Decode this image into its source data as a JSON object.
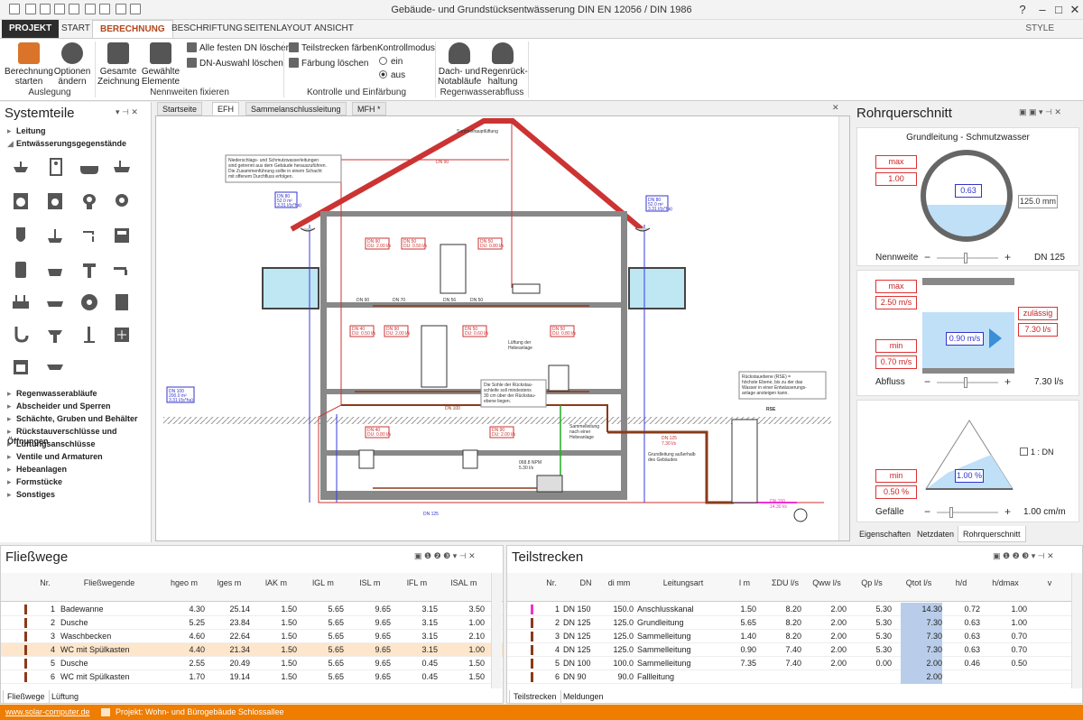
{
  "window": {
    "title": "Gebäude- und Grundstücksentwässerung DIN EN 12056 / DIN 1986",
    "style_label": "STYLE"
  },
  "ribbon_tabs": [
    "PROJEKT",
    "START",
    "BERECHNUNG",
    "BESCHRIFTUNG",
    "SEITENLAYOUT",
    "ANSICHT"
  ],
  "ribbon": {
    "btn_start": "Berechnung starten",
    "btn_options": "Optionen ändern",
    "grp_ausl": "Auslegung",
    "btn_whole": "Gesamte Zeichnung",
    "btn_sel": "Gewählte Elemente",
    "fix_all": "Alle festen DN löschen",
    "dn_clear": "DN-Auswahl löschen",
    "grp_nenn": "Nennweiten fixieren",
    "color_parts": "Teilstrecken färben",
    "color_clear": "Färbung löschen",
    "mode_title": "Kontrollmodus",
    "mode_on": "ein",
    "mode_off": "aus",
    "grp_ktrl": "Kontrolle und Einfärbung",
    "btn_roof": "Dach- und Notabläufe",
    "btn_rain": "Regenrück-haltung",
    "grp_rain": "Regenwasserabfluss"
  },
  "left": {
    "title": "Systemteile",
    "items": [
      "Leitung",
      "Entwässerungsgegenstände",
      "Regenwasserabläufe",
      "Abscheider und Sperren",
      "Schächte, Gruben und Behälter",
      "Rückstauverschlüsse und Öffnungen",
      "Lüftungsanschlüsse",
      "Ventile und Armaturen",
      "Hebeanlagen",
      "Formstücke",
      "Sonstiges"
    ]
  },
  "doc_tabs": [
    "Startseite",
    "EFH",
    "Sammelanschlussleitung",
    "MFH *"
  ],
  "drawing": {
    "note1": [
      "Niederschlags- und Schmutzwasserleitungen",
      "sind getrennt aus dem Gebäude herauszuführen.",
      "Die Zusammenführung sollte in einem Schacht",
      "mit offenem Durchfluss erfolgen."
    ],
    "note2": [
      "Rückstauebene (RSE) =",
      "höchste Ebene, bis zu der das",
      "Wasser in einer Entwässerungs-",
      "anlage ansteigen kann."
    ],
    "note3": [
      "Die Sohle der Rückstau-",
      "schleife soll mindestens",
      "30 cm über der Rückstau-",
      "ebene liegen."
    ],
    "vent": "Sammelhauptlüftung",
    "lift_vent": [
      "Lüftung der",
      "Hebeanlage"
    ],
    "lift": [
      "Sammelleitung",
      "nach einer",
      "Hebeanlage"
    ],
    "ground": [
      "Grundleitung außerhalb",
      "des Gebäudes"
    ],
    "rse": "RSE",
    "dn90": "DN 90",
    "dn70": "DN 70",
    "dn56": "DN 56",
    "dn50": "DN 50",
    "dn100": "DN 100",
    "dn125": "DN 125",
    "roof_l": [
      "DN 80",
      "52.0 m²",
      "3.31 l/(s*ha)"
    ],
    "roof_r": [
      "DN 80",
      "52.0 m²",
      "3.31 l/(s*ha)"
    ],
    "rain": [
      "DN 100",
      "200.0 m²",
      "3.31 l/(s*ha)"
    ],
    "dn125b": [
      "DN 125",
      "7.30 l/s"
    ],
    "dn150": [
      "DN 150",
      "14.30 l/s"
    ],
    "pump": [
      "068.8 NPM",
      "5.30 l/s"
    ],
    "fix": [
      "DN 90",
      "DU: 2.00 l/s",
      "DN 50",
      "DU: 0.50 l/s",
      "DN 50",
      "DU: 0.80 l/s",
      "DN 40",
      "DU: 0.50 l/s",
      "DN 90",
      "DU: 2.00 l/s",
      "DN 50",
      "DU: 0.60 l/s",
      "DN 50",
      "DU: 0.80 l/s",
      "DN 40",
      "DU: 0.80 l/s",
      "DN 90",
      "DU: 2.00 l/s"
    ]
  },
  "rohr": {
    "title": "Rohrquerschnitt",
    "sub": "Grundleitung - Schmutzwasser",
    "max": "max",
    "fill_max": "1.00",
    "fill_cur": "0.63",
    "dim": "125.0 mm",
    "nenn_lbl": "Nennweite",
    "nenn_val": "DN 125",
    "vmax": "max",
    "vmax_val": "2.50 m/s",
    "vcur": "0.90 m/s",
    "vmin": "min",
    "vmin_val": "0.70 m/s",
    "zul": "zulässig",
    "zul_val": "7.30 l/s",
    "abfl_lbl": "Abfluss",
    "abfl_val": "7.30 l/s",
    "smin": "min",
    "smin_val": "0.50 %",
    "scur": "1.00 %",
    "ratio": "1 : DN",
    "gef_lbl": "Gefälle",
    "gef_val": "1.00 cm/m",
    "tabs": [
      "Eigenschaften",
      "Netzdaten",
      "Rohrquerschnitt"
    ]
  },
  "fliess": {
    "title": "Fließwege",
    "cols": [
      "Nr.",
      "Fließwegende",
      "hgeo m",
      "lges m",
      "lAK m",
      "lGL m",
      "lSL m",
      "lFL m",
      "lSAL m"
    ],
    "rows": [
      [
        "1",
        "Badewanne",
        "4.30",
        "25.14",
        "1.50",
        "5.65",
        "9.65",
        "3.15",
        "3.50"
      ],
      [
        "2",
        "Dusche",
        "5.25",
        "23.84",
        "1.50",
        "5.65",
        "9.65",
        "3.15",
        "1.00"
      ],
      [
        "3",
        "Waschbecken",
        "4.60",
        "22.64",
        "1.50",
        "5.65",
        "9.65",
        "3.15",
        "2.10"
      ],
      [
        "4",
        "WC mit Spülkasten",
        "4.40",
        "21.34",
        "1.50",
        "5.65",
        "9.65",
        "3.15",
        "1.00"
      ],
      [
        "5",
        "Dusche",
        "2.55",
        "20.49",
        "1.50",
        "5.65",
        "9.65",
        "0.45",
        "1.50"
      ],
      [
        "6",
        "WC mit Spülkasten",
        "1.70",
        "19.14",
        "1.50",
        "5.65",
        "9.65",
        "0.45",
        "1.50"
      ]
    ],
    "tabs": [
      "Fließwege",
      "Lüftung"
    ]
  },
  "teil": {
    "title": "Teilstrecken",
    "cols": [
      "Nr.",
      "DN",
      "di mm",
      "Leitungsart",
      "l m",
      "ΣDU l/s",
      "Qww l/s",
      "Qp l/s",
      "Qtot l/s",
      "h/d",
      "h/dmax",
      "v"
    ],
    "rows": [
      [
        "1",
        "DN 150",
        "150.0",
        "Anschlusskanal",
        "1.50",
        "8.20",
        "2.00",
        "5.30",
        "14.30",
        "0.72",
        "1.00"
      ],
      [
        "2",
        "DN 125",
        "125.0",
        "Grundleitung",
        "5.65",
        "8.20",
        "2.00",
        "5.30",
        "7.30",
        "0.63",
        "1.00"
      ],
      [
        "3",
        "DN 125",
        "125.0",
        "Sammelleitung",
        "1.40",
        "8.20",
        "2.00",
        "5.30",
        "7.30",
        "0.63",
        "0.70"
      ],
      [
        "4",
        "DN 125",
        "125.0",
        "Sammelleitung",
        "0.90",
        "7.40",
        "2.00",
        "5.30",
        "7.30",
        "0.63",
        "0.70"
      ],
      [
        "5",
        "DN 100",
        "100.0",
        "Sammelleitung",
        "7.35",
        "7.40",
        "2.00",
        "0.00",
        "2.00",
        "0.46",
        "0.50"
      ],
      [
        "6",
        "DN 90",
        "90.0",
        "Fallleitung",
        "",
        "",
        "",
        "",
        "2.00",
        "",
        ""
      ]
    ],
    "tabs": [
      "Teilstrecken",
      "Meldungen"
    ]
  },
  "status": {
    "link": "www.solar-computer.de",
    "project": "Projekt: Wohn- und Bürogebäude Schlossallee"
  }
}
